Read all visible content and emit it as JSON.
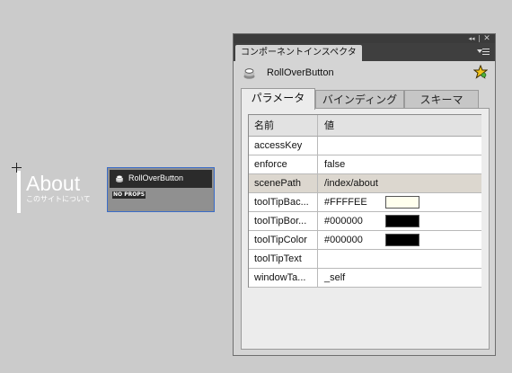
{
  "stage": {
    "about_title": "About",
    "about_subtitle": "このサイトについて",
    "component_instance": {
      "label": "RollOverButton",
      "badge": "NO PROPS"
    }
  },
  "panel": {
    "title": "コンポーネントインスペクタ",
    "collapse_glyph": "◂◂",
    "close_glyph": "✕",
    "component_name": "RollOverButton",
    "tabs": [
      {
        "label": "パラメータ",
        "active": true
      },
      {
        "label": "バインディング",
        "active": false
      },
      {
        "label": "スキーマ",
        "active": false
      }
    ],
    "grid": {
      "headers": {
        "name": "名前",
        "value": "値"
      },
      "rows": [
        {
          "name": "accessKey",
          "value": ""
        },
        {
          "name": "enforce",
          "value": "false"
        },
        {
          "name": "scenePath",
          "value": "/index/about",
          "selected": true
        },
        {
          "name": "toolTipBac...",
          "value": "#FFFFEE",
          "swatch": "#FFFFEE"
        },
        {
          "name": "toolTipBor...",
          "value": "#000000",
          "swatch": "#000000"
        },
        {
          "name": "toolTipColor",
          "value": "#000000",
          "swatch": "#000000"
        },
        {
          "name": "toolTipText",
          "value": ""
        },
        {
          "name": "windowTa...",
          "value": "_self"
        }
      ]
    }
  },
  "colors": {
    "stage_bg": "#cbcbcb",
    "panel_bg": "#d4d4d4",
    "titlebar": "#3f3f3f",
    "selection_border": "#3a6cc8",
    "selected_row": "#dcd7cf"
  },
  "icons": [
    "registration-cross-icon",
    "component-icon",
    "star-icon",
    "collapse-icon",
    "close-icon",
    "panel-menu-icon"
  ]
}
